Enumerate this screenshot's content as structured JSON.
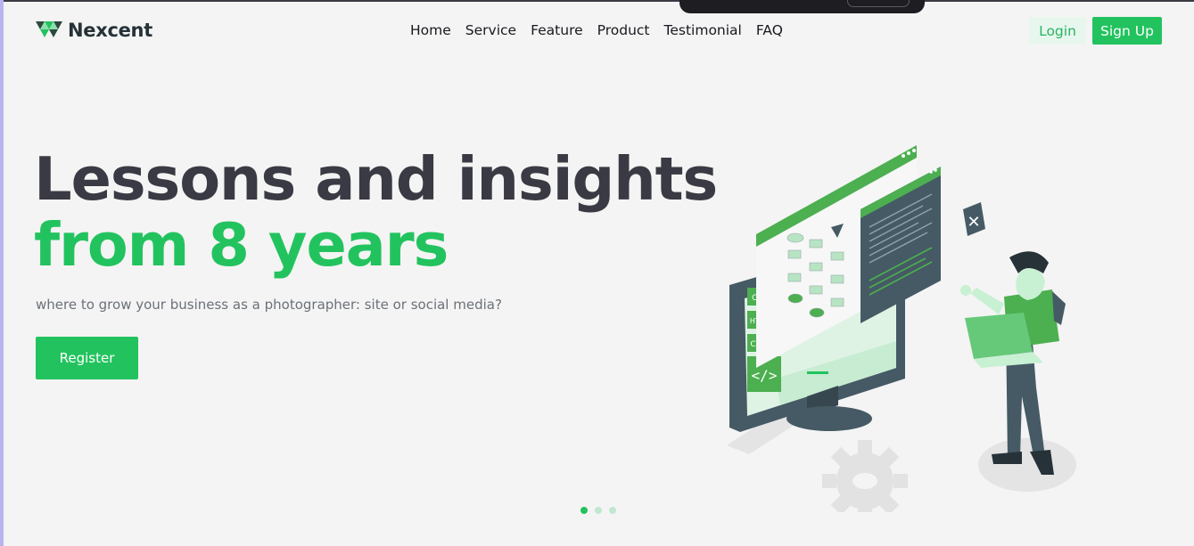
{
  "header": {
    "brand": "Nexcent",
    "nav": [
      "Home",
      "Service",
      "Feature",
      "Product",
      "Testimonial",
      "FAQ"
    ],
    "login_label": "Login",
    "signup_label": "Sign Up"
  },
  "hero": {
    "title_line1": "Lessons and insights",
    "title_line2": "from 8 years",
    "subtitle": "where to grow your business as a photographer: site or social media?",
    "register_label": "Register"
  },
  "illustration": {
    "badges": [
      "CSS",
      "HTML",
      "C++"
    ]
  },
  "carousel": {
    "active_index": 0,
    "count": 3
  },
  "colors": {
    "accent": "#22c35e",
    "text_dark": "#3a3a44",
    "background": "#f4f4f4",
    "login_bg": "#e8f7ee"
  }
}
